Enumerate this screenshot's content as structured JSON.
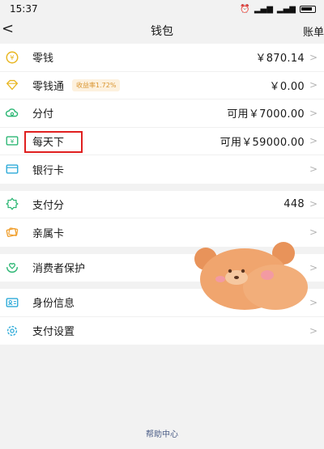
{
  "status": {
    "time": "15:37"
  },
  "nav": {
    "title": "钱包",
    "right_label": "账单"
  },
  "groups": [
    [
      {
        "label": "零钱",
        "value": "￥870.14",
        "icon": "coin-icon"
      },
      {
        "label": "零钱通",
        "badge": "收益率1.72%",
        "value": "￥0.00",
        "icon": "diamond-icon"
      },
      {
        "label": "分付",
        "value": "可用￥7000.00",
        "icon": "cloud-icon"
      },
      {
        "label": "每天下",
        "value": "可用￥59000.00",
        "icon": "yuan-card-icon"
      },
      {
        "label": "银行卡",
        "value": "",
        "icon": "bank-card-icon"
      }
    ],
    [
      {
        "label": "支付分",
        "value": "448",
        "icon": "pay-score-icon"
      },
      {
        "label": "亲属卡",
        "value": "",
        "icon": "family-card-icon"
      }
    ],
    [
      {
        "label": "消费者保护",
        "value": "",
        "icon": "shield-hands-icon"
      }
    ],
    [
      {
        "label": "身份信息",
        "value": "",
        "icon": "id-card-icon"
      },
      {
        "label": "支付设置",
        "value": "",
        "icon": "settings-gear-icon"
      }
    ]
  ],
  "footer": {
    "help_label": "帮助中心"
  },
  "colors": {
    "green": "#2bb673",
    "orange": "#f0a030",
    "highlight": "#e02020"
  }
}
